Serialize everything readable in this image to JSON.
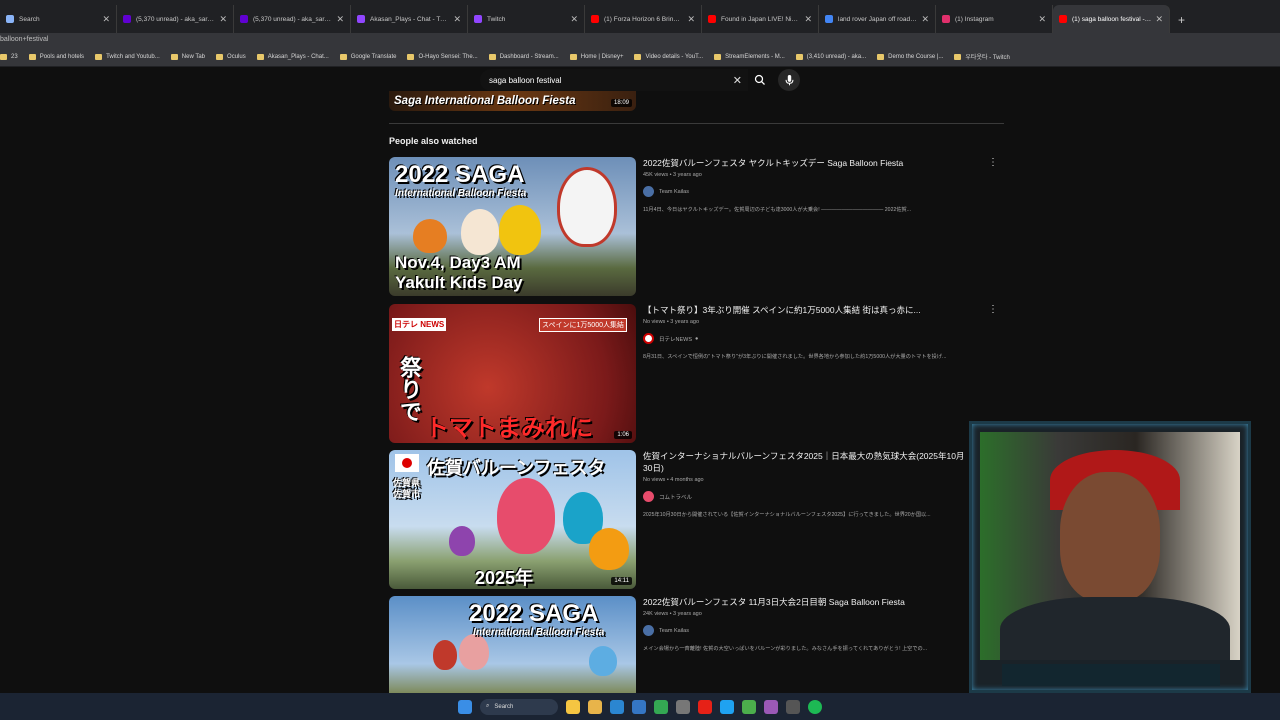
{
  "tabs": [
    {
      "label": "Search",
      "color": "#8ab4f8"
    },
    {
      "label": "(5,370 unread) - aka_saru@yah",
      "color": "#6001d2"
    },
    {
      "label": "(5,370 unread) - aka_saru@yah",
      "color": "#6001d2"
    },
    {
      "label": "Akasan_Plays - Chat - Twitch",
      "color": "#9146ff"
    },
    {
      "label": "Twitch",
      "color": "#9146ff"
    },
    {
      "label": "(1) Forza Horizon 6 Brings Back",
      "color": "#ff0000"
    },
    {
      "label": "Found in Japan LIVE! Night Dri",
      "color": "#ff0000"
    },
    {
      "label": "land rover Japan off road - Go",
      "color": "#4285f4"
    },
    {
      "label": "(1) Instagram",
      "color": "#e1306c"
    },
    {
      "label": "(1) saga balloon festival - Yo",
      "color": "#ff0000",
      "active": true
    }
  ],
  "address": "balloon+festival",
  "bookmarks": [
    "23",
    "Pools and hotels",
    "Twitch and Youtub...",
    "New Tab",
    "Oculus",
    "Akasan_Plays - Chat...",
    "Google Translate",
    "O-Hayo Sensei: The...",
    "Dashboard - Stream...",
    "Home | Disney+",
    "Video details - YouT...",
    "StreamElements - M...",
    "(3,410 unread) - aka...",
    "Demo the Course |...",
    "우타웃타 - Twitch"
  ],
  "search": {
    "query": "saga balloon festival"
  },
  "top_thumb": {
    "title": "Saga International Balloon Fiesta",
    "duration": "18:09"
  },
  "section_title": "People also watched",
  "videos": [
    {
      "title": "2022佐賀バルーンフェスタ ヤクルトキッズデー Saga Balloon Fiesta",
      "meta": "45K views • 3 years ago",
      "channel": "Team Kailas",
      "desc": "11月4日、今日はヤクルトキッズデー。佐賀周辺の子ども達3000人が大乗会! ———————————— 2022佐賀...",
      "thumb_line1": "2022 SAGA",
      "thumb_line2": "International Balloon Fiesta",
      "thumb_line3": "Nov.4, Day3 AM",
      "thumb_line4": "Yakult Kids Day",
      "duration": ""
    },
    {
      "title": "【トマト祭り】3年ぶり開催 スペインに約1万5000人集結 街は真っ赤に...",
      "meta": "No views • 3 years ago",
      "channel": "日テレNEWS",
      "desc": "8月31日、スペインで恒例の\"トマト祭り\"が3年ぶりに開催されました。世界各地から参加した約1万5000人が大量のトマトを投げ...",
      "thumb_line1": "日テレ NEWS",
      "thumb_line2": "祭りで",
      "thumb_line3": "トマトまみれに",
      "thumb_line4": "スペインに1万5000人集結",
      "duration": "1:06"
    },
    {
      "title": "佐賀インターナショナルバルーンフェスタ2025｜日本最大の熱気球大会(2025年10月30日)",
      "meta": "No views • 4 months ago",
      "channel": "コムトラベル",
      "desc": "2025年10月30日から開催されている【佐賀インターナショナルバルーンフェスタ2025】に行ってきました。世界20か国以...",
      "thumb_line1": "佐賀バルーンフェスタ",
      "thumb_line2": "佐賀県 佐賀市",
      "thumb_line3": "2025年",
      "thumb_line4": "",
      "duration": "14:11"
    },
    {
      "title": "2022佐賀バルーンフェスタ 11月3日大会2日目朝 Saga Balloon Fiesta",
      "meta": "24K views • 3 years ago",
      "channel": "Team Kailas",
      "desc": "メイン会場から一斉離陸! 佐賀の大空いっぱいをバルーンが彩りました。みなさん手を振ってくれてありがとう! 上空での...",
      "thumb_line1": "2022 SAGA",
      "thumb_line2": "International Balloon Fiesta",
      "thumb_line3": "",
      "thumb_line4": "",
      "duration": ""
    }
  ],
  "taskbar": {
    "search_label": "Search"
  }
}
